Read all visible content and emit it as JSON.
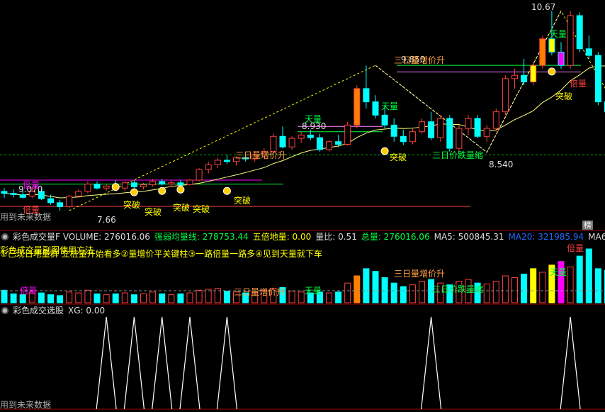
{
  "colors": {
    "up": "#ff4040",
    "down": "#00ffff",
    "green": "#00ff40",
    "yellow": "#ffff00",
    "magenta": "#ff00ff",
    "white": "#ffffff",
    "orange": "#ff8000"
  },
  "main": {
    "watermark": "用到未来数据",
    "price_labels": {
      "high": "10.67",
      "low_left": "7.66",
      "p1": "8.930",
      "p2": "9.070",
      "p3": "8.540",
      "p4": "9.850"
    },
    "annotations": {
      "tianliang_1": "天量",
      "tianliang_2": "天量",
      "tianliang_3": "天量",
      "beiliang_1": "倍量",
      "beiliang_2": "倍量",
      "sanri_1": "三日量增价升",
      "sanri_2": "三日量增价升",
      "jiadie": "三日价跌量缩",
      "tupo": "突破"
    },
    "rank_badge": "榜"
  },
  "volume_panel": {
    "header": {
      "name": "彩色成交量F",
      "volume": "VOLUME: 276016.06",
      "qrjl": "强弱均量线: 278753.44",
      "wbdl": "五倍地量: 0.00",
      "lb": "量比: 0.51",
      "zl": "总量: 276016.06",
      "ma5": "MA5: 500845.31",
      "ma20": "MA20: 321985.94",
      "ma60": "MA60"
    },
    "overlay_1": "彩色成交量副图使用方法",
    "overlay_2": "①已现日地量群 立桩量开始看多②量增价平关键柱③一路倍量一路多④见到天量就下车",
    "labels": {
      "sanri": "三日量增价升",
      "jiadie": "三日价跌量缩",
      "sanri_left": "三日量增价升",
      "beiliang": "倍量",
      "tianliang_1": "天量",
      "tianliang_2": "天量",
      "beiliang_top": "倍量",
      "beiliang_right": "倍量"
    }
  },
  "xg_panel": {
    "header": "彩色成交选股",
    "xg": "XG: 0.00",
    "watermark": "用到未来数据",
    "signals": [
      0,
      0,
      0,
      0,
      0,
      0,
      0,
      0,
      0,
      0,
      0,
      1,
      0,
      0,
      1,
      0,
      0,
      1,
      0,
      0,
      1,
      0,
      0,
      0,
      1,
      0,
      0,
      0,
      0,
      0,
      0,
      0,
      0,
      0,
      0,
      0,
      0,
      0,
      0,
      0,
      0,
      0,
      0,
      0,
      0,
      0,
      1,
      0,
      0,
      0,
      0,
      0,
      0,
      0,
      0,
      0,
      0,
      0,
      0,
      0,
      0,
      1,
      0,
      0,
      0,
      0
    ]
  },
  "chart_data": {
    "type": "candlestick",
    "price_range": [
      7.5,
      10.75
    ],
    "candles": [
      {
        "o": 7.95,
        "h": 8.0,
        "l": 7.85,
        "c": 7.92
      },
      {
        "o": 7.92,
        "h": 7.98,
        "l": 7.86,
        "c": 7.9
      },
      {
        "o": 7.9,
        "h": 7.96,
        "l": 7.84,
        "c": 7.86
      },
      {
        "o": 7.88,
        "h": 8.02,
        "l": 7.85,
        "c": 7.95
      },
      {
        "o": 7.95,
        "h": 8.0,
        "l": 7.82,
        "c": 7.84
      },
      {
        "o": 7.84,
        "h": 7.9,
        "l": 7.75,
        "c": 7.78
      },
      {
        "o": 7.78,
        "h": 7.82,
        "l": 7.66,
        "c": 7.72
      },
      {
        "o": 7.72,
        "h": 7.9,
        "l": 7.7,
        "c": 7.88
      },
      {
        "o": 7.88,
        "h": 7.98,
        "l": 7.86,
        "c": 7.95
      },
      {
        "o": 7.95,
        "h": 8.1,
        "l": 7.92,
        "c": 8.06
      },
      {
        "o": 8.06,
        "h": 8.1,
        "l": 7.98,
        "c": 8.0
      },
      {
        "o": 8.0,
        "h": 8.06,
        "l": 7.96,
        "c": 8.03
      },
      {
        "o": 8.03,
        "h": 8.12,
        "l": 7.98,
        "c": 8.0
      },
      {
        "o": 8.0,
        "h": 8.1,
        "l": 7.96,
        "c": 8.08
      },
      {
        "o": 8.08,
        "h": 8.12,
        "l": 8.0,
        "c": 8.02
      },
      {
        "o": 8.02,
        "h": 8.08,
        "l": 7.98,
        "c": 8.05
      },
      {
        "o": 8.05,
        "h": 8.14,
        "l": 8.02,
        "c": 8.1
      },
      {
        "o": 8.1,
        "h": 8.14,
        "l": 8.04,
        "c": 8.06
      },
      {
        "o": 8.06,
        "h": 8.12,
        "l": 8.02,
        "c": 8.08
      },
      {
        "o": 8.08,
        "h": 8.12,
        "l": 8.03,
        "c": 8.05
      },
      {
        "o": 8.05,
        "h": 8.14,
        "l": 8.04,
        "c": 8.12
      },
      {
        "o": 8.12,
        "h": 8.3,
        "l": 8.1,
        "c": 8.28
      },
      {
        "o": 8.28,
        "h": 8.4,
        "l": 8.22,
        "c": 8.35
      },
      {
        "o": 8.35,
        "h": 8.45,
        "l": 8.3,
        "c": 8.42
      },
      {
        "o": 8.42,
        "h": 8.5,
        "l": 8.36,
        "c": 8.4
      },
      {
        "o": 8.4,
        "h": 8.48,
        "l": 8.34,
        "c": 8.46
      },
      {
        "o": 8.46,
        "h": 8.52,
        "l": 8.4,
        "c": 8.44
      },
      {
        "o": 8.44,
        "h": 8.55,
        "l": 8.4,
        "c": 8.5
      },
      {
        "o": 8.5,
        "h": 8.6,
        "l": 8.45,
        "c": 8.55
      },
      {
        "o": 8.55,
        "h": 8.82,
        "l": 8.52,
        "c": 8.78
      },
      {
        "o": 8.78,
        "h": 8.93,
        "l": 8.6,
        "c": 8.62
      },
      {
        "o": 8.62,
        "h": 8.78,
        "l": 8.58,
        "c": 8.75
      },
      {
        "o": 8.75,
        "h": 8.85,
        "l": 8.68,
        "c": 8.8
      },
      {
        "o": 8.8,
        "h": 8.88,
        "l": 8.72,
        "c": 8.76
      },
      {
        "o": 8.76,
        "h": 8.82,
        "l": 8.55,
        "c": 8.58
      },
      {
        "o": 8.58,
        "h": 8.72,
        "l": 8.55,
        "c": 8.7
      },
      {
        "o": 8.7,
        "h": 8.8,
        "l": 8.62,
        "c": 8.66
      },
      {
        "o": 8.66,
        "h": 9.0,
        "l": 8.64,
        "c": 8.95
      },
      {
        "o": 8.95,
        "h": 9.55,
        "l": 8.9,
        "c": 9.5
      },
      {
        "o": 9.5,
        "h": 9.85,
        "l": 9.2,
        "c": 9.3
      },
      {
        "o": 9.3,
        "h": 9.4,
        "l": 9.05,
        "c": 9.1
      },
      {
        "o": 9.1,
        "h": 9.25,
        "l": 8.9,
        "c": 8.95
      },
      {
        "o": 8.95,
        "h": 9.05,
        "l": 8.7,
        "c": 8.78
      },
      {
        "o": 8.78,
        "h": 8.88,
        "l": 8.65,
        "c": 8.7
      },
      {
        "o": 8.7,
        "h": 8.9,
        "l": 8.66,
        "c": 8.85
      },
      {
        "o": 8.85,
        "h": 9.05,
        "l": 8.82,
        "c": 9.0
      },
      {
        "o": 9.0,
        "h": 9.15,
        "l": 8.72,
        "c": 8.76
      },
      {
        "o": 8.76,
        "h": 9.1,
        "l": 8.7,
        "c": 9.05
      },
      {
        "o": 9.05,
        "h": 9.1,
        "l": 8.55,
        "c": 8.6
      },
      {
        "o": 8.6,
        "h": 8.95,
        "l": 8.55,
        "c": 8.9
      },
      {
        "o": 8.9,
        "h": 9.1,
        "l": 8.8,
        "c": 9.05
      },
      {
        "o": 9.05,
        "h": 9.1,
        "l": 8.75,
        "c": 8.78
      },
      {
        "o": 8.78,
        "h": 8.95,
        "l": 8.7,
        "c": 8.9
      },
      {
        "o": 8.9,
        "h": 9.2,
        "l": 8.85,
        "c": 9.15
      },
      {
        "o": 9.15,
        "h": 9.7,
        "l": 9.1,
        "c": 9.65
      },
      {
        "o": 9.65,
        "h": 9.8,
        "l": 9.5,
        "c": 9.7
      },
      {
        "o": 9.7,
        "h": 9.95,
        "l": 9.55,
        "c": 9.6
      },
      {
        "o": 9.6,
        "h": 9.9,
        "l": 9.55,
        "c": 9.85
      },
      {
        "o": 9.85,
        "h": 10.3,
        "l": 9.8,
        "c": 10.25
      },
      {
        "o": 10.25,
        "h": 10.67,
        "l": 10.0,
        "c": 10.05
      },
      {
        "o": 10.05,
        "h": 10.2,
        "l": 9.8,
        "c": 9.85
      },
      {
        "o": 9.85,
        "h": 10.67,
        "l": 9.8,
        "c": 10.6
      },
      {
        "o": 10.6,
        "h": 10.65,
        "l": 10.05,
        "c": 10.1
      },
      {
        "o": 10.1,
        "h": 10.3,
        "l": 9.95,
        "c": 10.0
      },
      {
        "o": 10.0,
        "h": 10.05,
        "l": 9.25,
        "c": 9.3
      },
      {
        "o": 9.3,
        "h": 9.4,
        "l": 9.1,
        "c": 9.15
      }
    ],
    "volumes": [
      14,
      10,
      9,
      12,
      11,
      9,
      8,
      12,
      11,
      14,
      10,
      9,
      10,
      11,
      9,
      10,
      12,
      10,
      9,
      10,
      11,
      14,
      15,
      16,
      13,
      12,
      11,
      12,
      14,
      16,
      17,
      13,
      12,
      11,
      12,
      11,
      12,
      22,
      30,
      38,
      35,
      28,
      22,
      18,
      20,
      24,
      26,
      22,
      20,
      24,
      26,
      22,
      21,
      24,
      30,
      28,
      32,
      38,
      34,
      42,
      46,
      40,
      52,
      60,
      38,
      36
    ]
  }
}
